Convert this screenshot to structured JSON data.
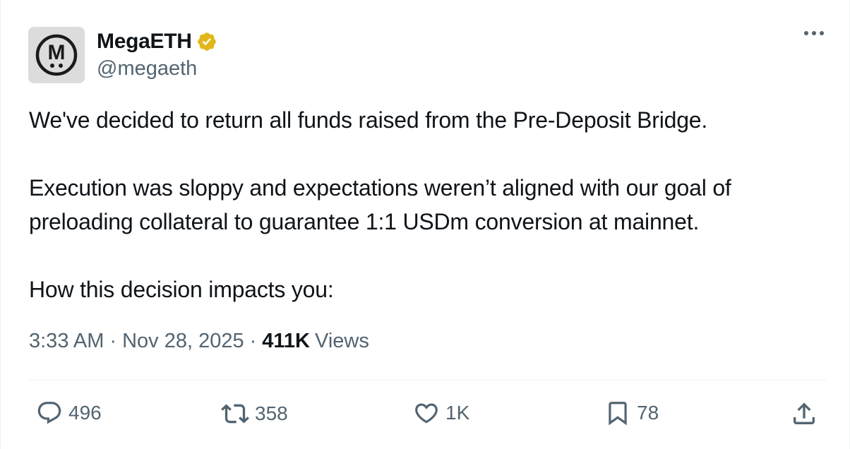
{
  "author": {
    "name": "MegaETH",
    "handle": "@megaeth",
    "avatar_letter": "M",
    "verified_badge_color": "#e2b719"
  },
  "tweet": {
    "paragraphs": [
      "We've decided to return all funds raised from the Pre-Deposit Bridge.",
      "Execution was sloppy and expectations weren’t aligned with our goal of preloading collateral to guarantee 1:1 USDm conversion at mainnet.",
      "How this decision impacts you:"
    ]
  },
  "meta": {
    "time": "3:33 AM",
    "separator": "·",
    "date": "Nov 28, 2025",
    "views_count": "411K",
    "views_label": "Views"
  },
  "actions": {
    "replies": "496",
    "reposts": "358",
    "likes": "1K",
    "bookmarks": "78"
  },
  "icons": [
    "avatar-logo",
    "verified-badge-icon",
    "more-icon",
    "reply-icon",
    "repost-icon",
    "like-icon",
    "bookmark-icon",
    "share-icon"
  ],
  "colors": {
    "text": "#0f1419",
    "secondary": "#536471",
    "divider": "#eff3f4"
  }
}
